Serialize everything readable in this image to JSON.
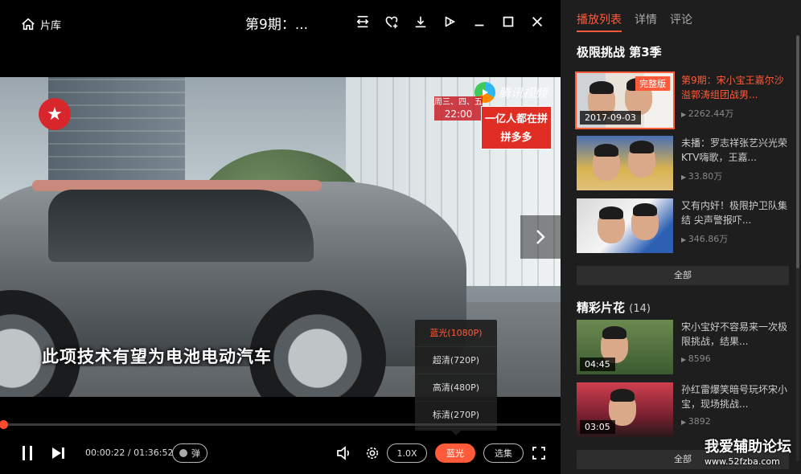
{
  "titlebar": {
    "home_label": "片库",
    "video_title": "第9期：...",
    "icons": [
      "fit-screen-icon",
      "favorite-add-icon",
      "download-icon",
      "share-icon",
      "minimize-icon",
      "maximize-icon",
      "close-icon"
    ]
  },
  "video": {
    "subtitle": "此项技术有望为电池电动汽车",
    "tencent_logo": "腾讯视频",
    "schedule_line1": "周三、四、五",
    "schedule_line2": "22:00",
    "ad_line1": "一亿人都在拼",
    "ad_line2": "拼多多"
  },
  "quality_menu": {
    "options": [
      "蓝光(1080P)",
      "超清(720P)",
      "高清(480P)",
      "标清(270P)"
    ],
    "selected": "蓝光(1080P)"
  },
  "progress": {
    "fraction": 0.0059
  },
  "controls": {
    "time": "00:00:22 / 01:36:52",
    "danmu_label": "弹",
    "speed_label": "1.0X",
    "quality_label": "蓝光",
    "episodes_label": "选集"
  },
  "sidebar": {
    "tabs": [
      "播放列表",
      "详情",
      "评论"
    ],
    "active_tab": "播放列表",
    "series_title": "极限挑战 第3季",
    "episodes": [
      {
        "title": "第9期：宋小宝王嘉尔沙溢郭涛组团战男...",
        "views": "2262.44万",
        "date": "2017-09-03",
        "badge": "完整版",
        "current": true
      },
      {
        "title": "未播：罗志祥张艺兴光荣KTV嗨歌，王嘉...",
        "views": "33.80万"
      },
      {
        "title": "又有内奸！极限护卫队集结 尖声警报吓...",
        "views": "346.86万"
      }
    ],
    "all_label": "全部",
    "clips_title": "精彩片花",
    "clips_count": "(14)",
    "clips": [
      {
        "title": "宋小宝好不容易来一次极限挑战，结果...",
        "views": "8596",
        "duration": "04:45"
      },
      {
        "title": "孙红雷爆笑暗号玩坏宋小宝，现场挑战...",
        "views": "3892",
        "duration": "03:05"
      }
    ],
    "all_label_2": "全部"
  },
  "watermark": {
    "main": "我爱辅助论坛",
    "url": "www.52fzba.com"
  },
  "colors": {
    "accent": "#ff5b3b",
    "sidebar_bg": "#1e1e1e",
    "player_bg": "#000000"
  }
}
